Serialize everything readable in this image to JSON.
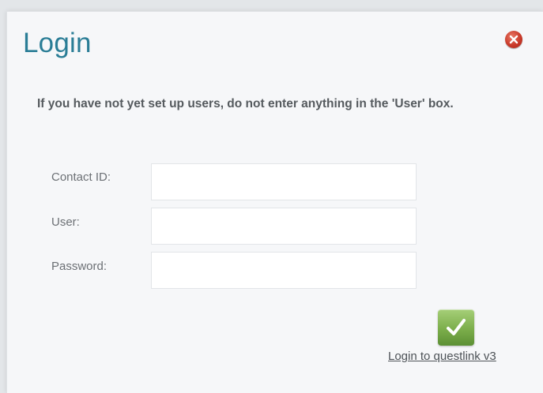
{
  "dialog": {
    "title": "Login",
    "close_icon": "close-icon",
    "notice": "If you have not yet set up users, do not enter anything in the 'User' box.",
    "fields": [
      {
        "label": "Contact ID:",
        "value": "",
        "placeholder": ""
      },
      {
        "label": "User:",
        "value": "",
        "placeholder": ""
      },
      {
        "label": "Password:",
        "value": "",
        "placeholder": ""
      }
    ],
    "submit_icon": "checkmark-icon",
    "submit_label": "Login to questlink v3"
  },
  "colors": {
    "title": "#2a7d96",
    "close": "#c93a2a",
    "submit": "#7cae4b",
    "text": "#555a5e"
  }
}
